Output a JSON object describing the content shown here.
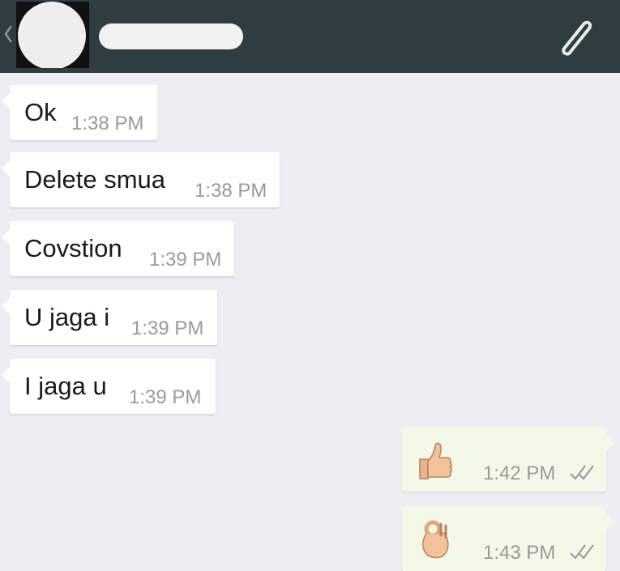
{
  "header": {
    "back_icon": "chevron-left-icon",
    "attach_icon": "paperclip-icon",
    "colors": {
      "bar": "#2f3d40",
      "redaction": "#f1f1f1"
    }
  },
  "messages": [
    {
      "direction": "incoming",
      "text": "Ok",
      "time": "1:38 PM"
    },
    {
      "direction": "incoming",
      "text": "Delete smua",
      "time": "1:38 PM"
    },
    {
      "direction": "incoming",
      "text": "Covstion",
      "time": "1:39 PM"
    },
    {
      "direction": "incoming",
      "text": "U jaga i",
      "time": "1:39 PM"
    },
    {
      "direction": "incoming",
      "text": "I jaga u",
      "time": "1:39 PM"
    },
    {
      "direction": "outgoing",
      "emoji": "thumbs-up-icon",
      "time": "1:42 PM",
      "status": "double-check-icon"
    },
    {
      "direction": "outgoing",
      "emoji": "ok-hand-icon",
      "time": "1:43 PM",
      "status": "double-check-icon"
    }
  ],
  "colors": {
    "background": "#eceef3",
    "incoming_bubble": "#ffffff",
    "outgoing_bubble": "#f3f8e8",
    "timestamp": "#9a9a9a"
  }
}
